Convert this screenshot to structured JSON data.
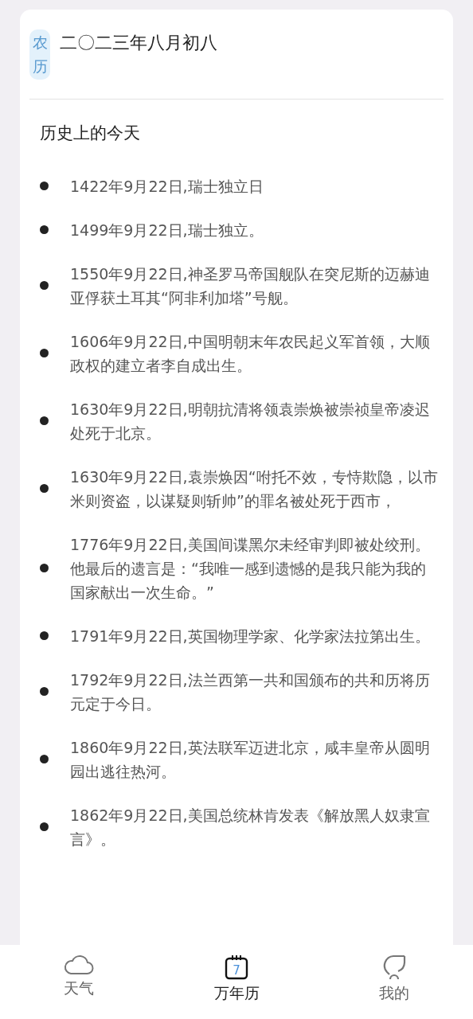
{
  "lunar": {
    "badge": "农历",
    "date": "二〇二三年八月初八"
  },
  "history": {
    "title": "历史上的今天",
    "events": [
      "1422年9月22日,瑞士独立日",
      "1499年9月22日,瑞士独立。",
      "1550年9月22日,神圣罗马帝国舰队在突尼斯的迈赫迪亚俘获土耳其“阿非利加塔”号舰。",
      "1606年9月22日,中国明朝末年农民起义军首领，大顺政权的建立者李自成出生。",
      "1630年9月22日,明朝抗清将领袁崇焕被崇祯皇帝凌迟处死于北京。",
      "1630年9月22日,袁崇焕因“咐托不效，专恃欺隐，以市米则资盗，以谋疑则斩帅”的罪名被处死于西市，",
      "1776年9月22日,美国间谍黑尔未经审判即被处绞刑。他最后的遗言是：“我唯一感到遗憾的是我只能为我的国家献出一次生命。”",
      "1791年9月22日,英国物理学家、化学家法拉第出生。",
      "1792年9月22日,法兰西第一共和国颁布的共和历将历元定于今日。",
      "1860年9月22日,英法联军迈进北京，咸丰皇帝从圆明园出逃往热河。",
      "1862年9月22日,美国总统林肯发表《解放黑人奴隶宣言》。"
    ]
  },
  "nav": [
    {
      "kind": "weather",
      "label": "天气",
      "selected": false
    },
    {
      "kind": "calendar",
      "label": "万年历",
      "selected": true,
      "icon_text": "7"
    },
    {
      "kind": "profile",
      "label": "我的",
      "selected": false
    }
  ]
}
